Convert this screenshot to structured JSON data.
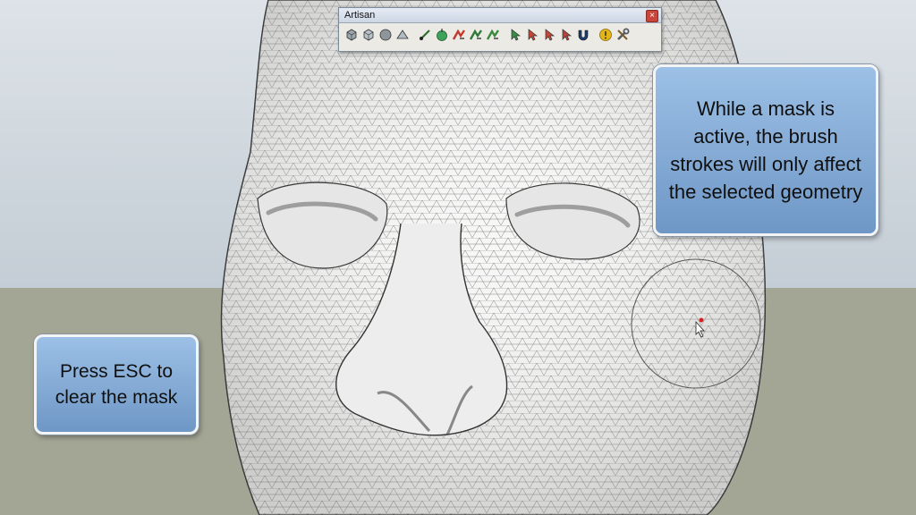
{
  "toolbar": {
    "title": "Artisan",
    "close_glyph": "×",
    "tools": [
      {
        "name": "subdivide-smooth-tool-icon",
        "color": "#9aa5ad"
      },
      {
        "name": "subdivide-quad-tool-icon",
        "color": "#b7c2c9"
      },
      {
        "name": "smooth-tool-icon",
        "color": "#8e969c"
      },
      {
        "name": "crease-tool-icon",
        "color": "#b0bcc4"
      },
      {
        "name": "sculpt-brush-icon",
        "color": "#2d6e2a"
      },
      {
        "name": "knife-subdivide-icon",
        "color": "#3ea35a"
      },
      {
        "name": "sculpt-add-icon",
        "color": "#c23a2e"
      },
      {
        "name": "sculpt-subtract-icon",
        "color": "#2f7a3a"
      },
      {
        "name": "sculpt-flatten-icon",
        "color": "#3a8a3d"
      },
      {
        "name": "select-vertices-icon",
        "color": "#3a8d44"
      },
      {
        "name": "soft-select-icon",
        "color": "#c44536"
      },
      {
        "name": "paint-select-icon",
        "color": "#c4473b"
      },
      {
        "name": "mask-select-icon",
        "color": "#b5433a"
      },
      {
        "name": "magnet-tool-icon",
        "color": "#1d3e6e"
      },
      {
        "name": "info-icon",
        "color": "#e4b517"
      },
      {
        "name": "settings-tools-icon",
        "color": "#555b62"
      }
    ]
  },
  "callout_right": {
    "lines": [
      "While a mask is",
      "active, the brush",
      "strokes will only affect",
      "the selected geometry"
    ]
  },
  "callout_left": {
    "lines": [
      "Press ESC to",
      "clear the mask"
    ]
  },
  "colors": {
    "callout_fill": "#86abd6",
    "sky": "#d0d8de",
    "ground": "#a3a595",
    "mesh_fill": "#f7f7f6",
    "mesh_line": "#3a3a3a"
  }
}
